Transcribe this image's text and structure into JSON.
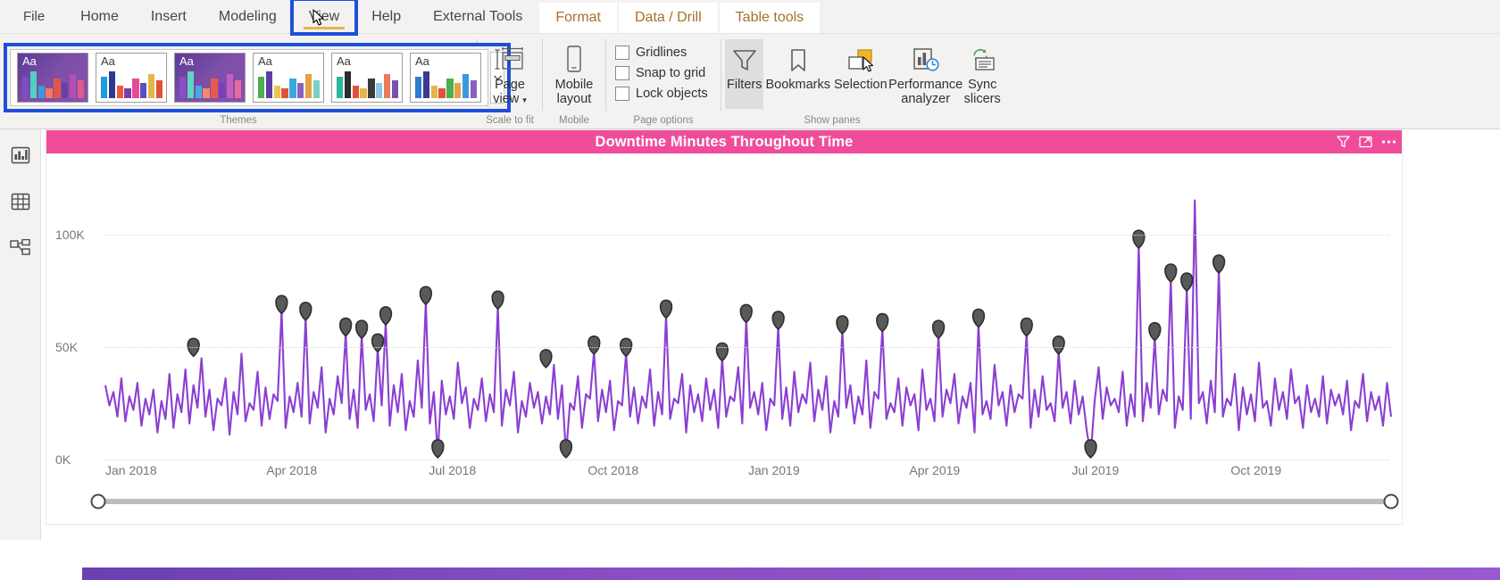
{
  "ribbon": {
    "tabs": [
      {
        "label": "File",
        "kind": "file"
      },
      {
        "label": "Home",
        "kind": "normal"
      },
      {
        "label": "Insert",
        "kind": "normal"
      },
      {
        "label": "Modeling",
        "kind": "normal"
      },
      {
        "label": "View",
        "kind": "active"
      },
      {
        "label": "Help",
        "kind": "normal"
      },
      {
        "label": "External Tools",
        "kind": "normal"
      },
      {
        "label": "Format",
        "kind": "contextual"
      },
      {
        "label": "Data / Drill",
        "kind": "contextual"
      },
      {
        "label": "Table tools",
        "kind": "contextual"
      }
    ],
    "groups": {
      "themes": {
        "label": "Themes",
        "more_icon": "chevron-down-icon",
        "selected_index": 0,
        "thumbnails": [
          {
            "name": "Aa",
            "dark": true,
            "bars": [
              "#7b4fc0",
              "#4fd0c0",
              "#3a9bdc",
              "#f07a5a",
              "#e0574a",
              "#6a3fa8",
              "#b24fb0",
              "#e05a8a"
            ]
          },
          {
            "name": "Aa",
            "dark": false,
            "bars": [
              "#1f9bde",
              "#2b3a8f",
              "#f0583c",
              "#7a3fa8",
              "#e84a9a",
              "#5b4fc0",
              "#e8b44c",
              "#e0533a"
            ]
          },
          {
            "name": "Aa",
            "dark": true,
            "bars": [
              "#8a4fc8",
              "#5fd6c4",
              "#4aa8e0",
              "#f08a6a",
              "#e85a4a",
              "#7a3fb8",
              "#c45fc0",
              "#e86a9a"
            ]
          },
          {
            "name": "Aa",
            "dark": false,
            "bars": [
              "#4caf50",
              "#5b3fa8",
              "#e8c84c",
              "#e0533a",
              "#3aa8dc",
              "#8a5fc0",
              "#e8a040",
              "#7ad0c0"
            ]
          },
          {
            "name": "Aa",
            "dark": false,
            "bars": [
              "#2bb5a0",
              "#2b2b2b",
              "#e0533a",
              "#e8b44c",
              "#3a3a3a",
              "#8ac8e8",
              "#e87a5a",
              "#7a4fb0"
            ]
          },
          {
            "name": "Aa",
            "dark": false,
            "bars": [
              "#2b7fd0",
              "#3a3a8f",
              "#e8b44c",
              "#e0533a",
              "#4caf50",
              "#e8a040",
              "#3a9bdc",
              "#8a5fc0"
            ]
          }
        ]
      },
      "scale_to_fit": {
        "label": "Scale to fit",
        "buttons": [
          {
            "label": "Page\nview",
            "icon": "page-view-icon",
            "caret": true,
            "line1": "Page",
            "line2": "view"
          }
        ]
      },
      "mobile": {
        "label": "Mobile",
        "buttons": [
          {
            "icon": "mobile-layout-icon",
            "line1": "Mobile",
            "line2": "layout"
          }
        ]
      },
      "page_options": {
        "label": "Page options",
        "checkboxes": [
          {
            "label": "Gridlines",
            "checked": false
          },
          {
            "label": "Snap to grid",
            "checked": false
          },
          {
            "label": "Lock objects",
            "checked": false
          }
        ]
      },
      "show_panes": {
        "label": "Show panes",
        "buttons": [
          {
            "icon": "filter-funnel-icon",
            "line1": "Filters",
            "line2": "",
            "selected": true
          },
          {
            "icon": "bookmark-icon",
            "line1": "Bookmarks",
            "line2": "",
            "selected": false
          },
          {
            "icon": "selection-icon",
            "line1": "Selection",
            "line2": "",
            "selected": false
          },
          {
            "icon": "performance-analyzer-icon",
            "line1": "Performance",
            "line2": "analyzer",
            "selected": false
          },
          {
            "icon": "sync-slicers-icon",
            "line1": "Sync",
            "line2": "slicers",
            "selected": false
          }
        ]
      }
    }
  },
  "left_rail": {
    "items": [
      {
        "name": "report-view",
        "icon": "report-bar-chart-icon",
        "active": true
      },
      {
        "name": "data-view",
        "icon": "data-table-icon",
        "active": false
      },
      {
        "name": "model-view",
        "icon": "model-relationships-icon",
        "active": false
      }
    ]
  },
  "visual": {
    "title": "Downtime Minutes Throughout Time",
    "title_bg": "#ef4d9a",
    "line_color": "#8a3fd1",
    "anomaly_color": "#595959",
    "actions": [
      {
        "name": "filter-icon",
        "label": "Filters"
      },
      {
        "name": "focus-mode-icon",
        "label": "Focus mode"
      },
      {
        "name": "more-options-icon",
        "label": "More options"
      }
    ],
    "slider": {
      "left_value": 0,
      "right_value": 100
    }
  },
  "chart_data": {
    "type": "line",
    "title": "Downtime Minutes Throughout Time",
    "xlabel": "",
    "ylabel": "",
    "ylim": [
      0,
      120000
    ],
    "yticks": [
      0,
      50000,
      100000
    ],
    "ytick_labels": [
      "0K",
      "50K",
      "100K"
    ],
    "grid": true,
    "legend": null,
    "xtick_labels": [
      "Jan 2018",
      "Apr 2018",
      "Jul 2018",
      "Oct 2018",
      "Jan 2019",
      "Apr 2019",
      "Jul 2019",
      "Oct 2019"
    ],
    "xtick_positions": [
      0.02,
      0.145,
      0.27,
      0.395,
      0.52,
      0.645,
      0.77,
      0.895
    ],
    "series": [
      {
        "name": "Downtime Minutes",
        "color": "#8a3fd1",
        "values": [
          33000,
          24000,
          30000,
          19000,
          36000,
          17000,
          28000,
          22000,
          34000,
          15000,
          27000,
          20000,
          31000,
          12000,
          26000,
          18000,
          38000,
          14000,
          29000,
          21000,
          40000,
          16000,
          33000,
          23000,
          45000,
          19000,
          31000,
          13000,
          27000,
          24000,
          36000,
          11000,
          30000,
          20000,
          47000,
          17000,
          25000,
          22000,
          39000,
          15000,
          32000,
          18000,
          29000,
          26000,
          66000,
          14000,
          28000,
          21000,
          34000,
          19000,
          63000,
          16000,
          30000,
          23000,
          41000,
          12000,
          27000,
          20000,
          37000,
          25000,
          56000,
          18000,
          31000,
          14000,
          55000,
          22000,
          29000,
          17000,
          49000,
          24000,
          61000,
          15000,
          33000,
          21000,
          38000,
          13000,
          26000,
          19000,
          44000,
          23000,
          70000,
          16000,
          30000,
          2000,
          35000,
          20000,
          28000,
          18000,
          43000,
          25000,
          32000,
          14000,
          27000,
          22000,
          36000,
          17000,
          29000,
          21000,
          68000,
          15000,
          31000,
          24000,
          39000,
          12000,
          26000,
          19000,
          34000,
          23000,
          30000,
          16000,
          28000,
          20000,
          42000,
          18000,
          33000,
          2000,
          25000,
          22000,
          37000,
          14000,
          29000,
          27000,
          48000,
          17000,
          31000,
          21000,
          35000,
          13000,
          26000,
          24000,
          47000,
          19000,
          32000,
          16000,
          28000,
          23000,
          40000,
          15000,
          30000,
          20000,
          64000,
          18000,
          27000,
          25000,
          38000,
          12000,
          33000,
          21000,
          29000,
          17000,
          36000,
          22000,
          31000,
          14000,
          45000,
          19000,
          28000,
          26000,
          41000,
          16000,
          62000,
          23000,
          30000,
          20000,
          34000,
          13000,
          27000,
          24000,
          59000,
          18000,
          32000,
          15000,
          39000,
          21000,
          29000,
          25000,
          43000,
          17000,
          31000,
          22000,
          37000,
          12000,
          26000,
          19000,
          57000,
          23000,
          33000,
          16000,
          28000,
          20000,
          44000,
          14000,
          30000,
          27000,
          58000,
          18000,
          25000,
          21000,
          36000,
          15000,
          32000,
          24000,
          29000,
          13000,
          40000,
          22000,
          27000,
          17000,
          55000,
          19000,
          31000,
          25000,
          38000,
          16000,
          28000,
          23000,
          34000,
          12000,
          60000,
          20000,
          26000,
          18000,
          42000,
          24000,
          30000,
          15000,
          33000,
          21000,
          29000,
          27000,
          56000,
          14000,
          31000,
          19000,
          37000,
          22000,
          25000,
          17000,
          48000,
          23000,
          30000,
          16000,
          35000,
          20000,
          28000,
          13000,
          2000,
          26000,
          41000,
          18000,
          32000,
          24000,
          27000,
          21000,
          39000,
          15000,
          29000,
          19000,
          95000,
          17000,
          34000,
          23000,
          54000,
          20000,
          31000,
          26000,
          80000,
          14000,
          28000,
          22000,
          76000,
          18000,
          115000,
          25000,
          30000,
          16000,
          35000,
          21000,
          84000,
          19000,
          27000,
          24000,
          38000,
          13000,
          32000,
          20000,
          29000,
          17000,
          43000,
          23000,
          26000,
          15000,
          36000,
          22000,
          30000,
          18000,
          40000,
          25000,
          28000,
          14000,
          33000,
          21000,
          27000,
          19000,
          37000,
          16000,
          31000,
          24000,
          29000,
          20000,
          35000,
          13000,
          26000,
          23000,
          38000,
          17000,
          30000,
          22000,
          28000,
          15000,
          34000,
          19000
        ]
      }
    ],
    "anomalies": [
      {
        "index": 22,
        "value": 47000
      },
      {
        "index": 44,
        "value": 66000
      },
      {
        "index": 50,
        "value": 63000
      },
      {
        "index": 60,
        "value": 56000
      },
      {
        "index": 64,
        "value": 55000
      },
      {
        "index": 68,
        "value": 49000
      },
      {
        "index": 70,
        "value": 61000
      },
      {
        "index": 80,
        "value": 70000
      },
      {
        "index": 83,
        "value": 2000
      },
      {
        "index": 98,
        "value": 68000
      },
      {
        "index": 115,
        "value": 2000
      },
      {
        "index": 110,
        "value": 42000
      },
      {
        "index": 122,
        "value": 48000
      },
      {
        "index": 130,
        "value": 47000
      },
      {
        "index": 140,
        "value": 64000
      },
      {
        "index": 154,
        "value": 45000
      },
      {
        "index": 160,
        "value": 62000
      },
      {
        "index": 168,
        "value": 59000
      },
      {
        "index": 184,
        "value": 57000
      },
      {
        "index": 194,
        "value": 58000
      },
      {
        "index": 208,
        "value": 55000
      },
      {
        "index": 218,
        "value": 60000
      },
      {
        "index": 230,
        "value": 56000
      },
      {
        "index": 238,
        "value": 48000
      },
      {
        "index": 246,
        "value": 2000
      },
      {
        "index": 258,
        "value": 95000
      },
      {
        "index": 262,
        "value": 54000
      },
      {
        "index": 266,
        "value": 80000
      },
      {
        "index": 270,
        "value": 76000
      },
      {
        "index": 278,
        "value": 84000
      }
    ]
  }
}
